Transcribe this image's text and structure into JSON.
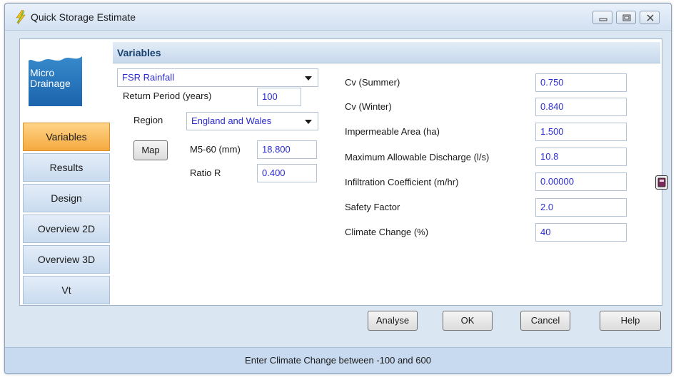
{
  "window": {
    "title": "Quick Storage Estimate",
    "controls": [
      "minimize",
      "maximize",
      "close"
    ]
  },
  "logo": {
    "line1": "Micro",
    "line2": "Drainage"
  },
  "nav": {
    "items": [
      {
        "label": "Variables",
        "active": true
      },
      {
        "label": "Results",
        "active": false
      },
      {
        "label": "Design",
        "active": false
      },
      {
        "label": "Overview 2D",
        "active": false
      },
      {
        "label": "Overview 3D",
        "active": false
      },
      {
        "label": "Vt",
        "active": false
      }
    ]
  },
  "panel": {
    "title": "Variables",
    "rainfall_method": "FSR Rainfall",
    "return_period": {
      "label": "Return Period (years)",
      "value": "100"
    },
    "region": {
      "label": "Region",
      "value": "England and Wales"
    },
    "map_button": "Map",
    "m5_60": {
      "label": "M5-60 (mm)",
      "value": "18.800"
    },
    "ratio_r": {
      "label": "Ratio R",
      "value": "0.400"
    },
    "cv_summer": {
      "label": "Cv (Summer)",
      "value": "0.750"
    },
    "cv_winter": {
      "label": "Cv (Winter)",
      "value": "0.840"
    },
    "impermeable_area": {
      "label": "Impermeable Area (ha)",
      "value": "1.500"
    },
    "max_discharge": {
      "label": "Maximum Allowable Discharge (l/s)",
      "value": "10.8"
    },
    "infiltration": {
      "label": "Infiltration Coefficient (m/hr)",
      "value": "0.00000"
    },
    "safety_factor": {
      "label": "Safety Factor",
      "value": "2.0"
    },
    "climate_change": {
      "label": "Climate Change (%)",
      "value": "40"
    }
  },
  "buttons": {
    "analyse": "Analyse",
    "ok": "OK",
    "cancel": "Cancel",
    "help": "Help"
  },
  "status": {
    "message": "Enter Climate Change between -100 and 600"
  },
  "colors": {
    "value_text": "#2b2bd0",
    "active_tab": "#f5a93f",
    "header_text": "#17406e",
    "logo_blue": "#1c64ad"
  }
}
